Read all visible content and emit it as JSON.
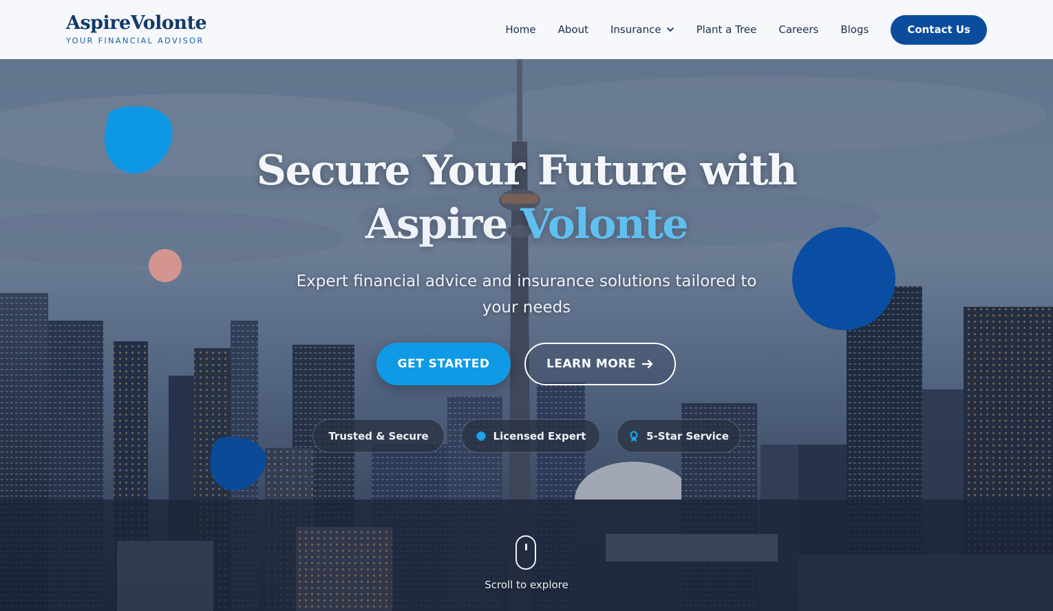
{
  "header": {
    "brand_name": "AspireVolonte",
    "brand_tagline": "YOUR FINANCIAL ADVISOR",
    "nav": [
      {
        "label": "Home"
      },
      {
        "label": "About"
      },
      {
        "label": "Insurance",
        "has_dropdown": true
      },
      {
        "label": "Plant a Tree"
      },
      {
        "label": "Careers"
      },
      {
        "label": "Blogs"
      }
    ],
    "contact_label": "Contact Us",
    "colors": {
      "brand": "#123a6b",
      "contact_button": "#0b4d9c"
    }
  },
  "hero": {
    "title_line1": "Secure Your Future with",
    "title_line2_part1": "Aspire ",
    "title_line2_part2": "Volonte",
    "subtitle": "Expert financial advice and insurance solutions tailored to your needs",
    "primary_button": "GET STARTED",
    "secondary_button": "LEARN MORE",
    "secondary_button_icon": "arrow-right-icon",
    "badges": [
      {
        "label": "Trusted & Secure",
        "icon": ""
      },
      {
        "label": "Licensed Expert",
        "icon": "badge-icon"
      },
      {
        "label": "5-Star Service",
        "icon": "award-icon"
      }
    ],
    "scroll_text": "Scroll to explore",
    "colors": {
      "accent": "#0f9ae6",
      "highlight": "#5fc0f0"
    }
  }
}
